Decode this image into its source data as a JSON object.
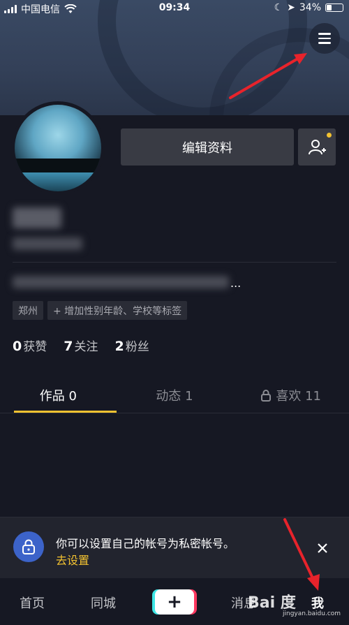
{
  "status_bar": {
    "carrier": "中国电信",
    "time": "09:34",
    "battery": "34%"
  },
  "profile": {
    "edit_label": "编辑资料",
    "bio_ellipsis": "...",
    "tags": [
      "郑州",
      "+ 增加性别年龄、学校等标签"
    ],
    "stats": [
      {
        "value": "0",
        "label": "获赞"
      },
      {
        "value": "7",
        "label": "关注"
      },
      {
        "value": "2",
        "label": "粉丝"
      }
    ]
  },
  "tabs": [
    {
      "label": "作品 0"
    },
    {
      "label": "动态 1"
    },
    {
      "label": "喜欢 11"
    }
  ],
  "banner": {
    "message": "你可以设置自己的帐号为私密帐号。",
    "link": "去设置"
  },
  "bottom_nav": {
    "home": "首页",
    "nearby": "同城",
    "plus": "+",
    "messages": "消息",
    "me": "我"
  },
  "watermark": {
    "text": "Bai 度",
    "sub": "jingyan.baidu.com"
  },
  "colors": {
    "accent": "#f3c231",
    "background": "#161823",
    "lock_blue": "#3c63c9",
    "arrow_red": "#e8232b"
  }
}
